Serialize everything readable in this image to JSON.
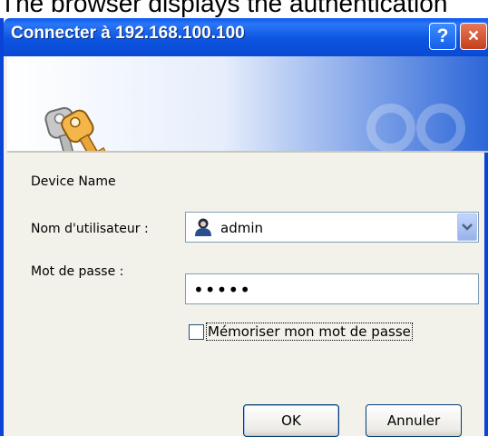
{
  "caption": "The browser displays the authentication",
  "dialog": {
    "title": "Connecter à 192.168.100.100",
    "help_symbol": "?",
    "close_symbol": "×",
    "device_name": "Device Name",
    "username": {
      "label": "Nom d'utilisateur :",
      "value": "admin"
    },
    "password": {
      "label": "Mot de passe :",
      "value": "•••••"
    },
    "remember": {
      "label": "Mémoriser mon mot de passe",
      "checked": false
    },
    "buttons": {
      "ok": "OK",
      "cancel": "Annuler"
    }
  },
  "colors": {
    "titlebar": "#0a4ad2",
    "window_body": "#f3f2ea",
    "input_border": "#7f9db9",
    "close_button": "#c4401a"
  },
  "icons": {
    "banner": "keys-icon",
    "user": "user-avatar-icon",
    "dropdown": "chevron-down-icon"
  }
}
